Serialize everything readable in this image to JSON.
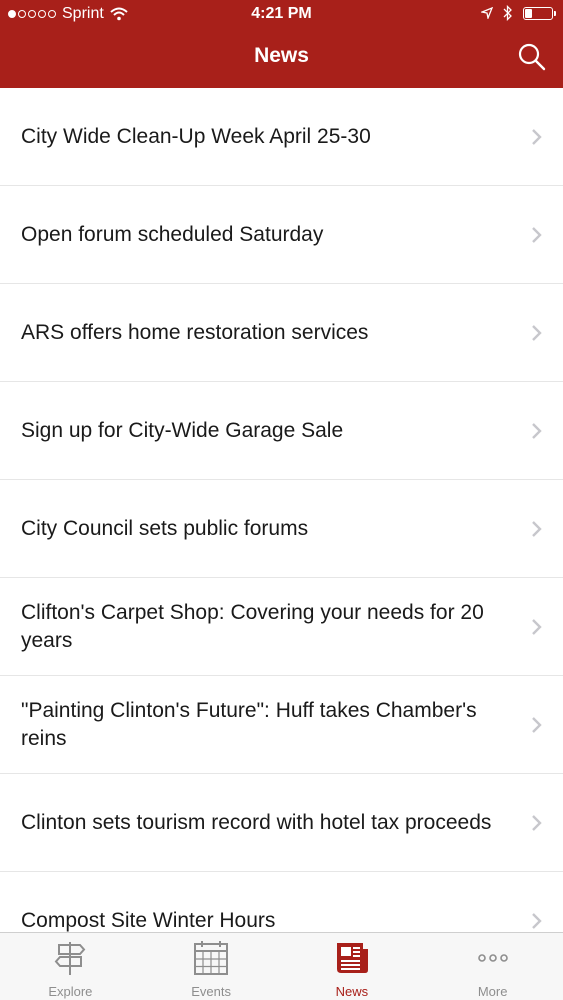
{
  "status_bar": {
    "carrier": "Sprint",
    "time": "4:21 PM",
    "signal_dots": 5,
    "signal_filled": 1,
    "battery_level": 0.2
  },
  "nav": {
    "title": "News",
    "search_icon": "search-icon"
  },
  "news_items": [
    {
      "title": "City Wide Clean-Up Week April 25-30"
    },
    {
      "title": "Open forum scheduled Saturday"
    },
    {
      "title": "ARS offers home restoration services"
    },
    {
      "title": "Sign up for City-Wide Garage Sale"
    },
    {
      "title": "City Council sets public forums"
    },
    {
      "title": "Clifton's Carpet Shop: Covering your needs for 20 years"
    },
    {
      "title": "\"Painting Clinton's Future\": Huff takes Chamber's reins"
    },
    {
      "title": "Clinton sets tourism record with hotel tax proceeds"
    },
    {
      "title": "Compost Site Winter Hours"
    }
  ],
  "tabs": [
    {
      "label": "Explore",
      "icon": "signpost-icon",
      "active": false
    },
    {
      "label": "Events",
      "icon": "calendar-icon",
      "active": false
    },
    {
      "label": "News",
      "icon": "newspaper-icon",
      "active": true
    },
    {
      "label": "More",
      "icon": "more-dots-icon",
      "active": false
    }
  ],
  "colors": {
    "header_bg": "#a8201a",
    "accent": "#a8201a",
    "tab_inactive": "#8e8e8e"
  }
}
